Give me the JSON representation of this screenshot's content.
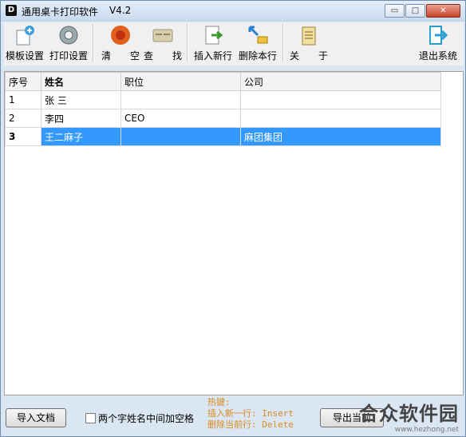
{
  "window": {
    "title": "通用桌卡打印软件",
    "version": "V4.2"
  },
  "window_buttons": {
    "minimize": "▭",
    "maximize": "□",
    "close": "✕"
  },
  "toolbar": {
    "items": [
      {
        "label": "模板设置",
        "icon": "template-add-icon"
      },
      {
        "label": "打印设置",
        "icon": "gear-icon"
      },
      {
        "label": "清　　空",
        "icon": "clear-icon"
      },
      {
        "label": "查　　找",
        "icon": "card-icon"
      },
      {
        "label": "插入新行",
        "icon": "insert-doc-icon"
      },
      {
        "label": "删除本行",
        "icon": "delete-row-icon"
      },
      {
        "label": "关　　于",
        "icon": "notepad-icon"
      },
      {
        "label": "退出系统",
        "icon": "exit-icon"
      }
    ]
  },
  "table": {
    "headers": [
      "序号",
      "姓名",
      "职位",
      "公司"
    ],
    "rows": [
      [
        "1",
        "张  三",
        "",
        ""
      ],
      [
        "2",
        "李四",
        "CEO",
        ""
      ],
      [
        "3",
        "王二麻子",
        "",
        "麻团集团"
      ]
    ],
    "selected_row": 3
  },
  "bottom": {
    "import_label": "导入文档",
    "checkbox_label": "两个字姓名中间加空格",
    "hotkey_title": "热键:",
    "hotkey_insert": "插入新一行: Insert",
    "hotkey_delete": "删除当前行: Delete",
    "export_label": "导出当前"
  },
  "watermark": {
    "name": "合众软件园",
    "url": "www.hezhong.net"
  }
}
